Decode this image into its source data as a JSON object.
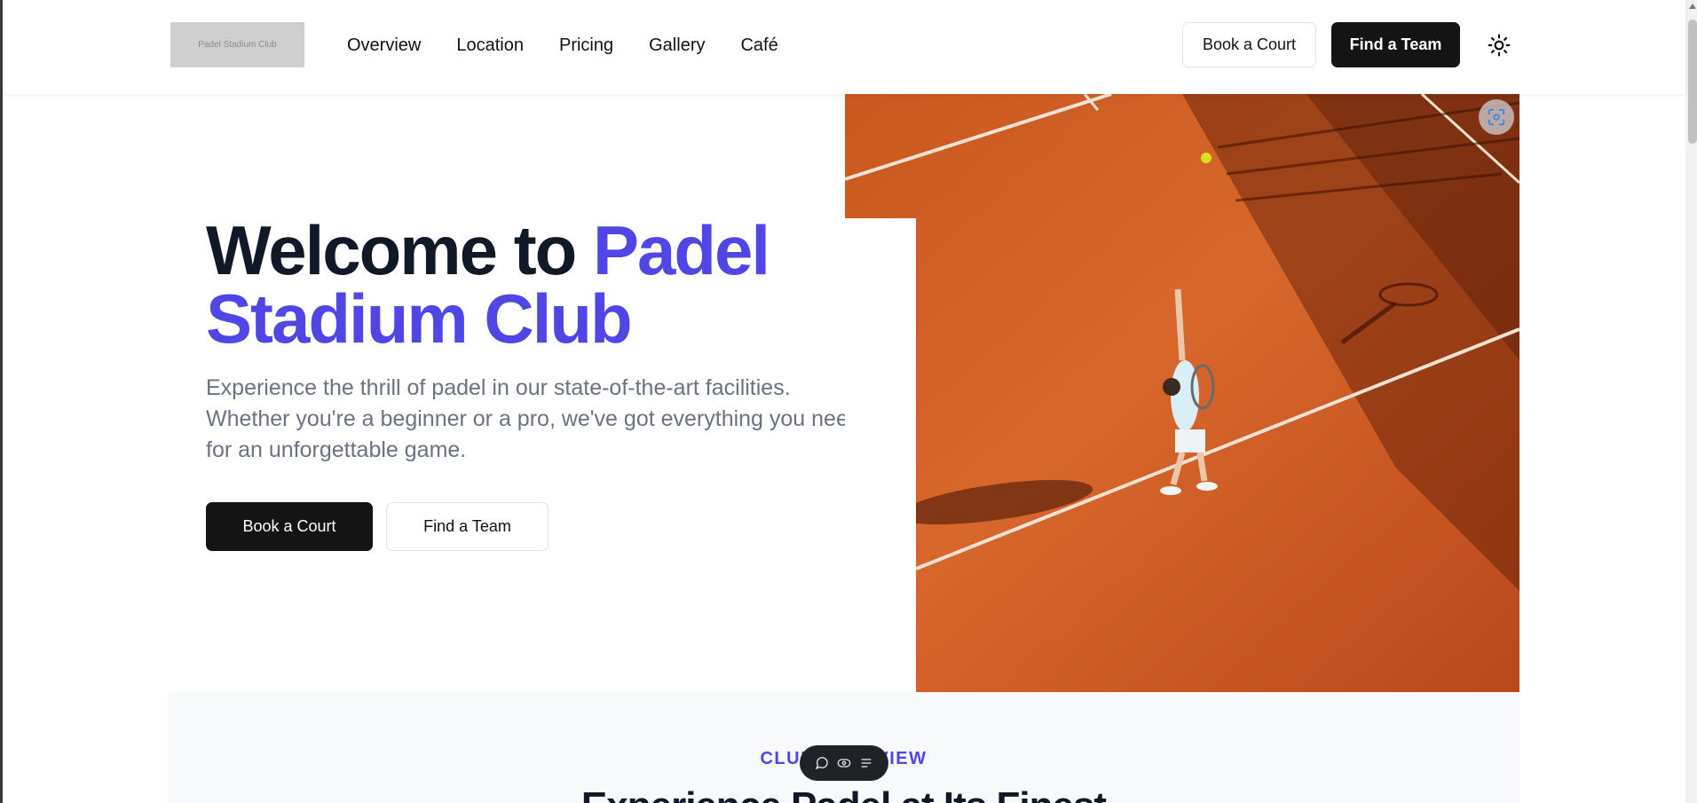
{
  "header": {
    "logo_text": "Padel Stadium Club",
    "nav": [
      "Overview",
      "Location",
      "Pricing",
      "Gallery",
      "Café"
    ],
    "book_label": "Book a Court",
    "team_label": "Find a Team",
    "theme_icon": "sun-icon"
  },
  "hero": {
    "title_prefix": "Welcome to ",
    "title_accent": "Padel Stadium Club",
    "description": "Experience the thrill of padel in our state-of-the-art facilities. Whether you're a beginner or a pro, we've got everything you need for an unforgettable game.",
    "book_label": "Book a Court",
    "team_label": "Find a Team",
    "accent_color": "#5046e5"
  },
  "overview": {
    "eyebrow": "CLUB OVERVIEW",
    "title": "Experience Padel at Its Finest"
  },
  "toolbar": {
    "icons": [
      "comment-icon",
      "eye-icon",
      "list-icon"
    ]
  }
}
